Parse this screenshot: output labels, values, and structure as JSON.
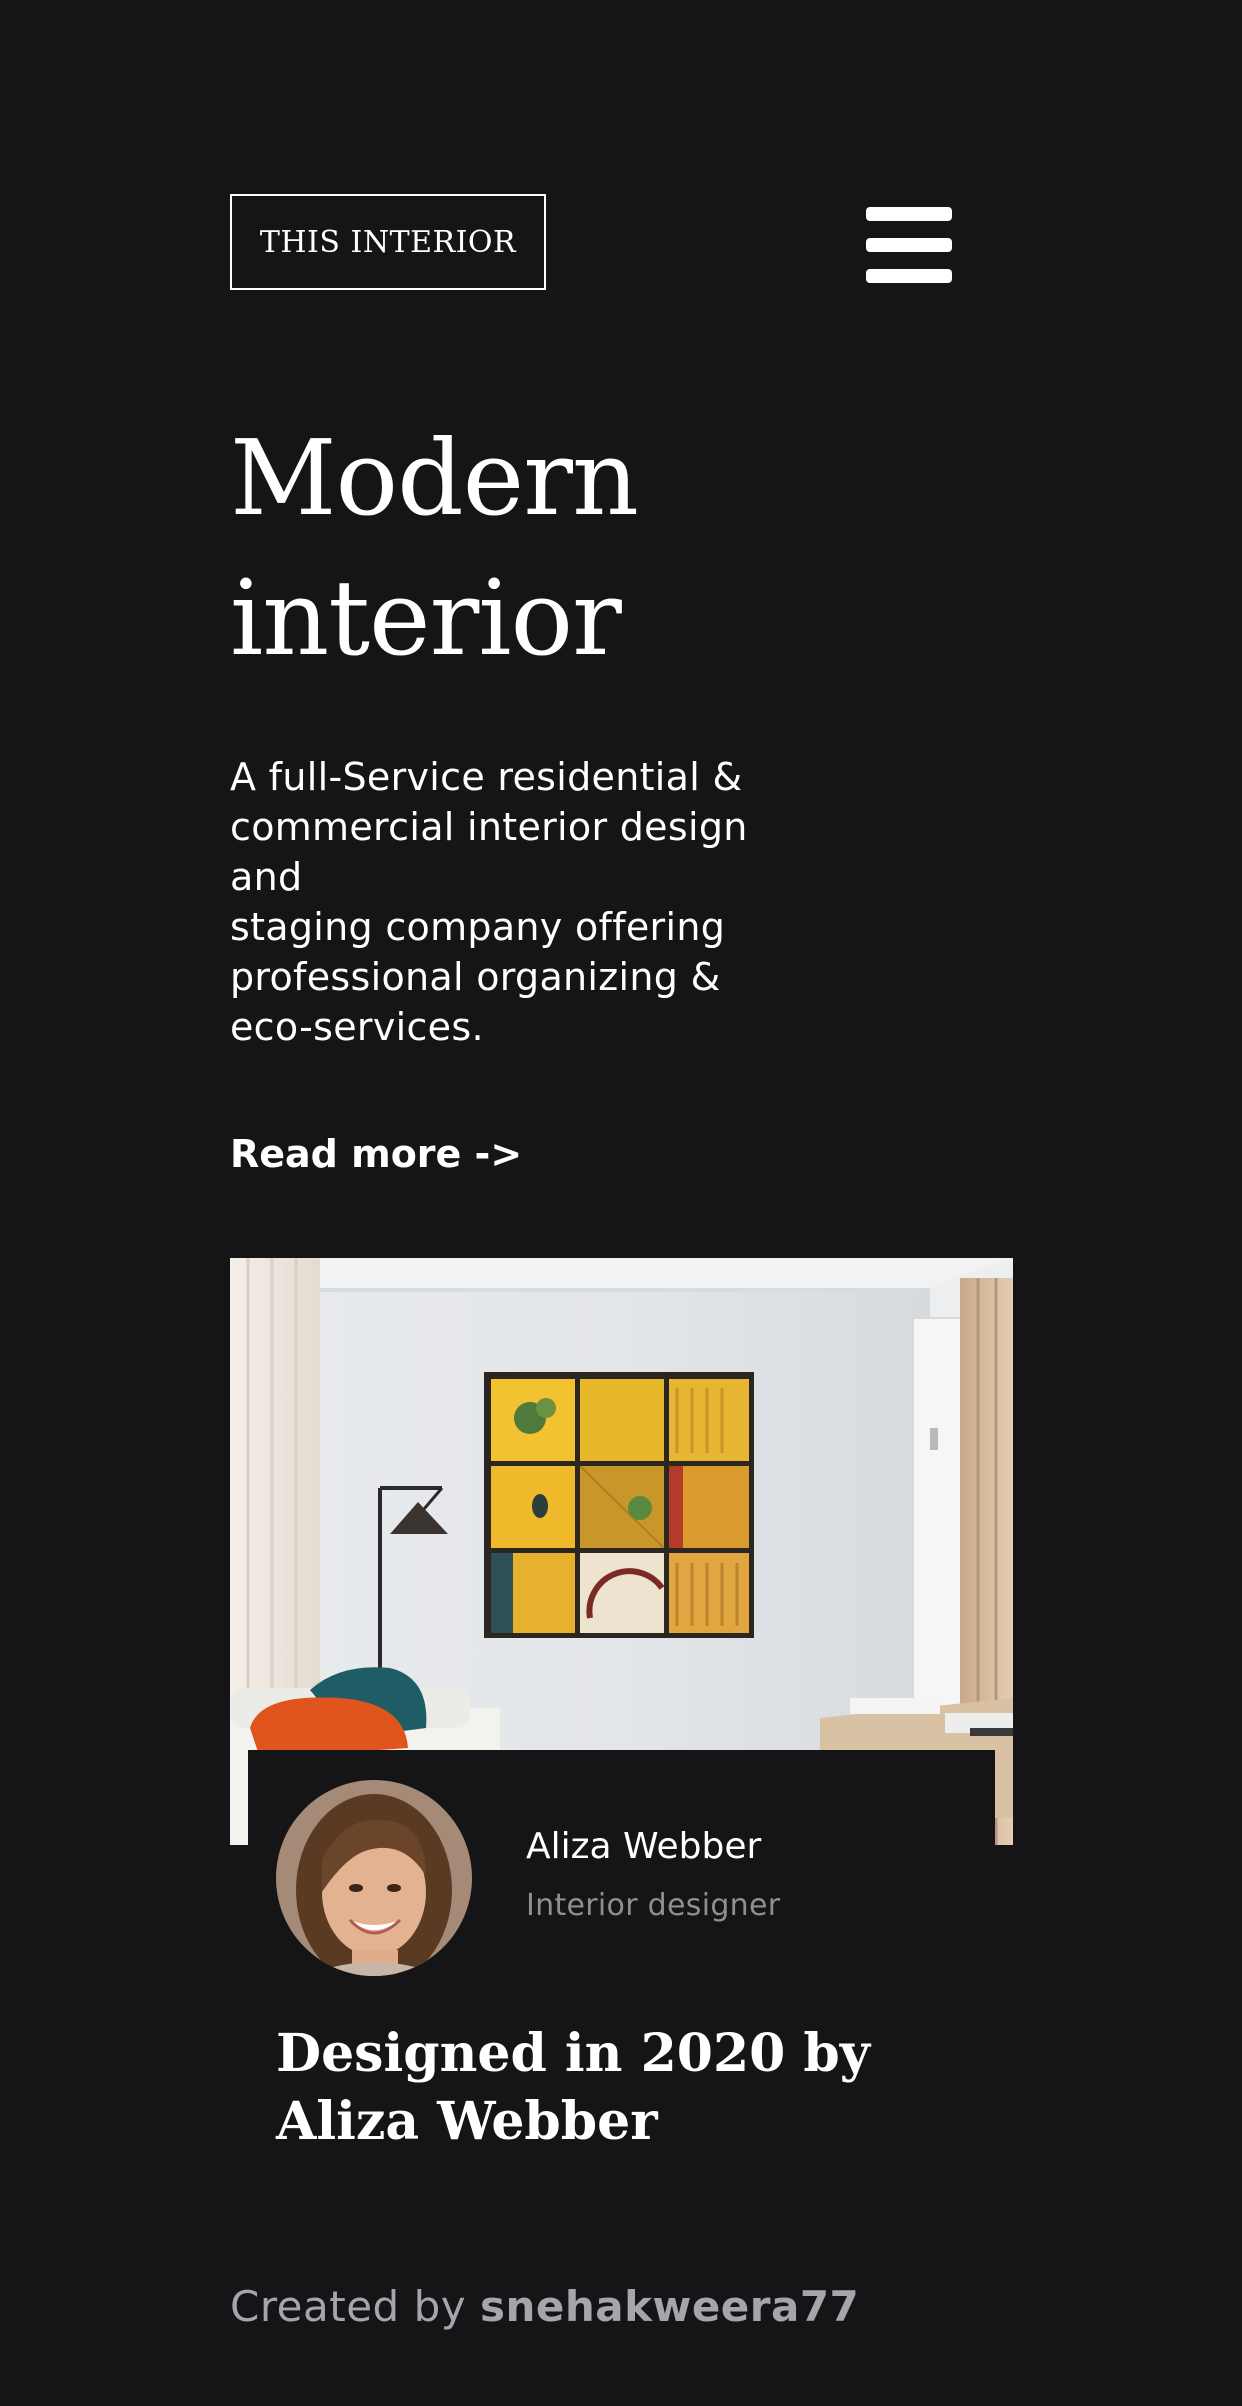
{
  "header": {
    "logo_text": "THIS INTERIOR",
    "menu_icon": "hamburger-menu-icon"
  },
  "hero": {
    "title_lines": [
      "Modern",
      "interior"
    ],
    "description_lines": [
      "A full-Service residential &",
      "commercial interior design",
      "and",
      "staging company offering",
      "professional organizing &",
      "eco-services."
    ],
    "read_more_label": "Read more ->"
  },
  "card": {
    "photo_alt": "Modern living room interior",
    "person_name": "Aliza Webber",
    "person_role": "Interior designer",
    "caption_lines": [
      "Designed in 2020 by",
      "Aliza Webber"
    ]
  },
  "footer": {
    "prefix": "Created by",
    "author": "snehakweera77"
  },
  "colors": {
    "background": "#151517",
    "text": "#ffffff",
    "muted": "#8f8f92",
    "footer": "#a6a6aa"
  }
}
